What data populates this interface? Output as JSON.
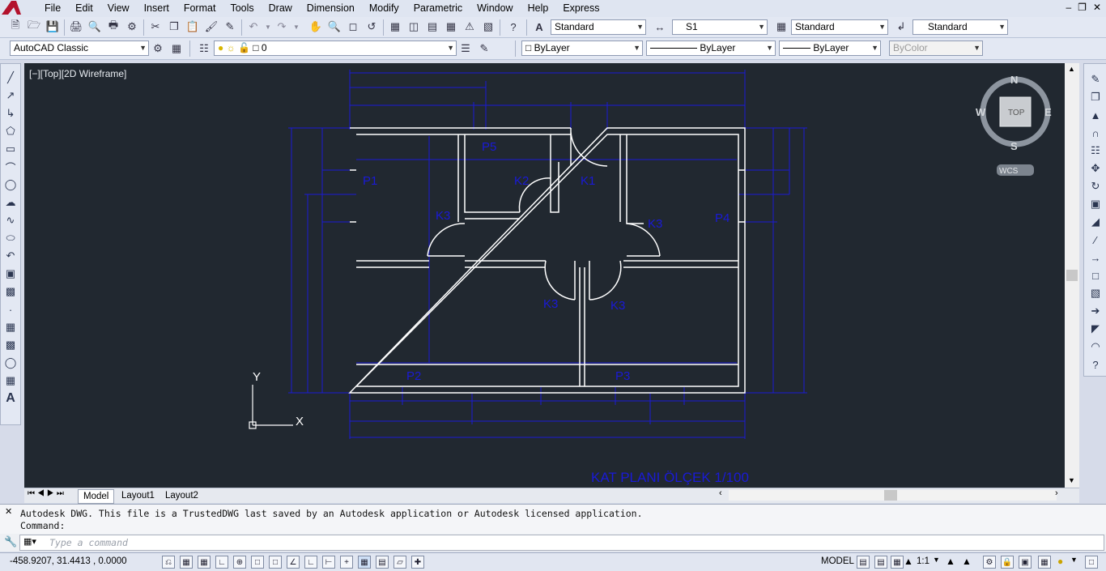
{
  "menu": {
    "items": [
      "File",
      "Edit",
      "View",
      "Insert",
      "Format",
      "Tools",
      "Draw",
      "Dimension",
      "Modify",
      "Parametric",
      "Window",
      "Help",
      "Express"
    ]
  },
  "toolbar1": {
    "text_style": "Standard",
    "dim_style": "S1",
    "table_style": "Standard",
    "multileader_style": "Standard"
  },
  "toolbar2": {
    "workspace": "AutoCAD Classic",
    "layer": "0",
    "color": "ByLayer",
    "linetype": "ByLayer",
    "lineweight": "ByLayer",
    "plotstyle": "ByColor"
  },
  "viewport": {
    "label": "[−][Top][2D Wireframe]",
    "viewcube": {
      "north": "N",
      "south": "S",
      "east": "E",
      "west": "W",
      "face": "TOP",
      "ucs": "WCS"
    },
    "ucs_x": "X",
    "ucs_y": "Y"
  },
  "drawing": {
    "title": "KAT PLANI ÖLÇEK 1/100",
    "labels": [
      "P1",
      "P5",
      "K2",
      "K1",
      "K3",
      "K3",
      "P4",
      "K3",
      "K3",
      "P2",
      "P3"
    ]
  },
  "tabs": [
    "Model",
    "Layout1",
    "Layout2"
  ],
  "command": {
    "history1": "Autodesk DWG.  This file is a TrustedDWG last saved by an Autodesk application or Autodesk licensed application.",
    "history2": "Command:",
    "placeholder": "Type a command"
  },
  "status": {
    "coords": "-458.9207, 31.4413 , 0.0000",
    "space": "MODEL",
    "scale": "1:1"
  },
  "colors": {
    "viewport_bg": "#212830",
    "walls": "#ffffff",
    "dims": "#1a1ad6",
    "accent": "#2b6cc4"
  }
}
